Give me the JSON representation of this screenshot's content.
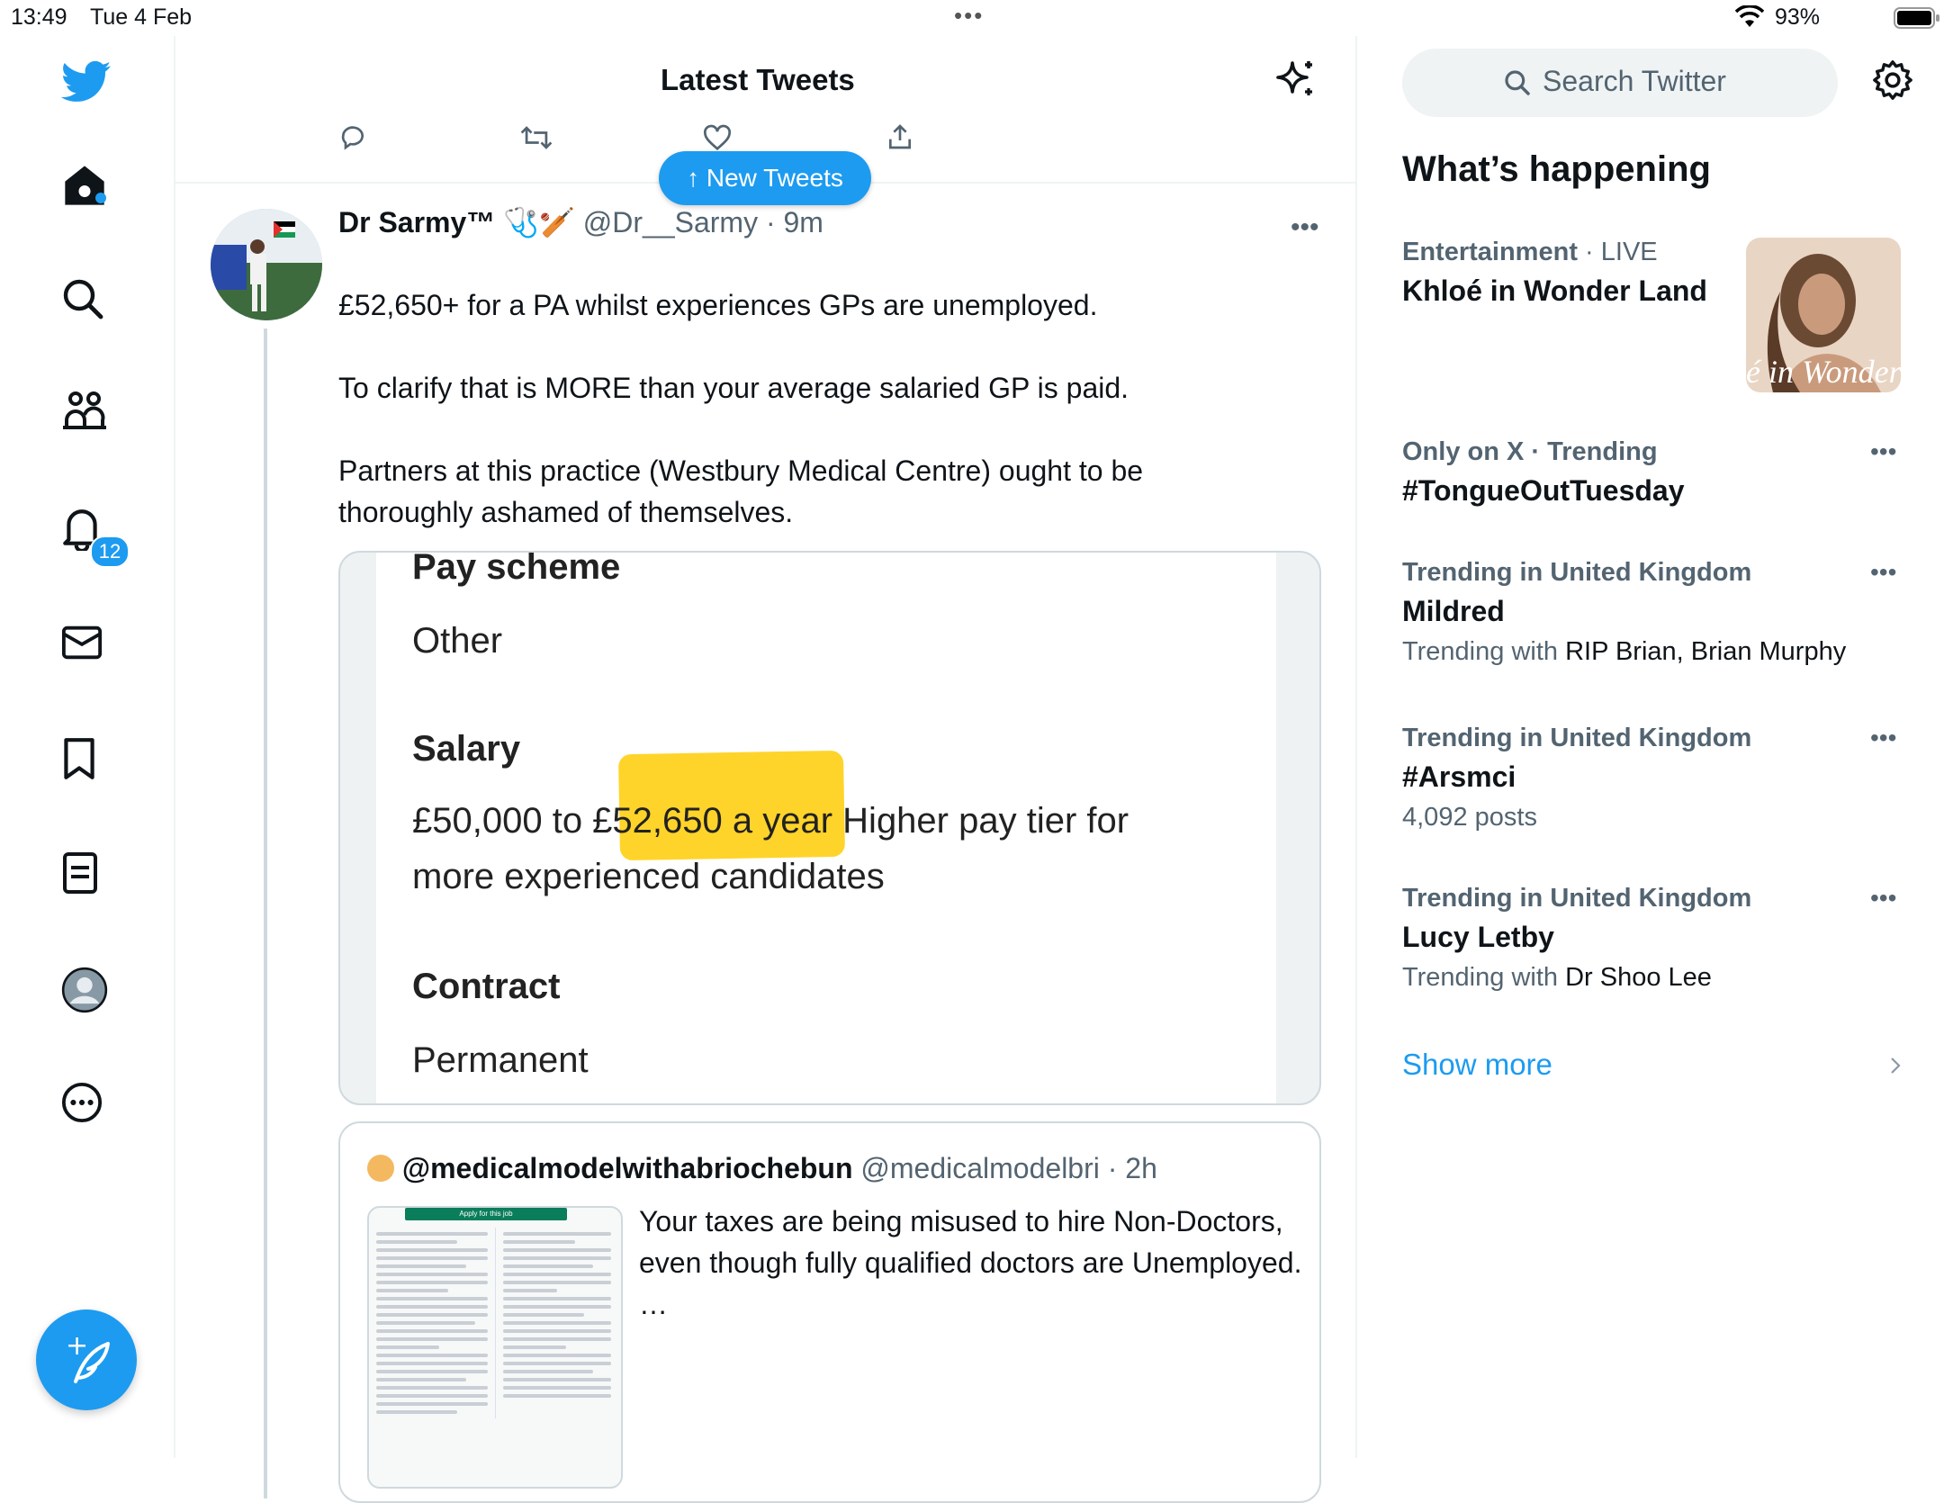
{
  "status": {
    "time": "13:49",
    "date": "Tue 4 Feb",
    "battery": "93%"
  },
  "nav": {
    "notifications_badge": "12",
    "items": [
      "twitter-logo",
      "home",
      "explore",
      "communities",
      "notifications",
      "messages",
      "bookmarks",
      "lists",
      "profile",
      "more"
    ]
  },
  "main": {
    "title": "Latest Tweets",
    "new_tweets_label": "↑ New Tweets",
    "tweet": {
      "name": "Dr Sarmy™",
      "name_emoji": "🩺🏏",
      "handle": "@Dr__Sarmy",
      "time": "· 9m",
      "text": "£52,650+ for a PA whilst experiences GPs are unemployed.\n\nTo clarify that is MORE than your average salaried GP is paid.\n\nPartners at this practice (Westbury Medical Centre) ought to be thoroughly ashamed of themselves.",
      "media": {
        "pay_scheme_label": "Pay scheme",
        "pay_scheme_value": "Other",
        "salary_label": "Salary",
        "salary_line1": "£50,000 to £52,650 a year Higher pay tier for",
        "salary_line2": "more experienced candidates",
        "contract_label": "Contract",
        "contract_value": "Permanent"
      },
      "quote": {
        "name": "@medicalmodelwithabriochebun",
        "handle": "@medicalmodelbri",
        "time": "· 2h",
        "text": "Your taxes are being misused to hire Non-Doctors, even though fully qualified doctors are Unemployed.\n…",
        "image_header": "Apply for this job"
      }
    }
  },
  "right": {
    "search_placeholder": "Search Twitter",
    "heading": "What’s happening",
    "trends": [
      {
        "context": "Entertainment",
        "context_extra": " · LIVE",
        "title": "Khloé in Wonder Land",
        "image_text": "é in Wonder L"
      },
      {
        "context": "Only on X · Trending",
        "title": "#TongueOutTuesday"
      },
      {
        "context": "Trending in United Kingdom",
        "title": "Mildred",
        "sub_prefix": "Trending with ",
        "sub_value": "RIP Brian, Brian Murphy"
      },
      {
        "context": "Trending in United Kingdom",
        "title": "#Arsmci",
        "sub": "4,092 posts"
      },
      {
        "context": "Trending in United Kingdom",
        "title": "Lucy Letby",
        "sub_prefix": "Trending with ",
        "sub_value": "Dr Shoo Lee"
      }
    ],
    "show_more": "Show more"
  },
  "colors": {
    "accent": "#1d9bf0",
    "muted": "#536471",
    "border": "#cfd9de",
    "highlight": "#ffd21f"
  }
}
